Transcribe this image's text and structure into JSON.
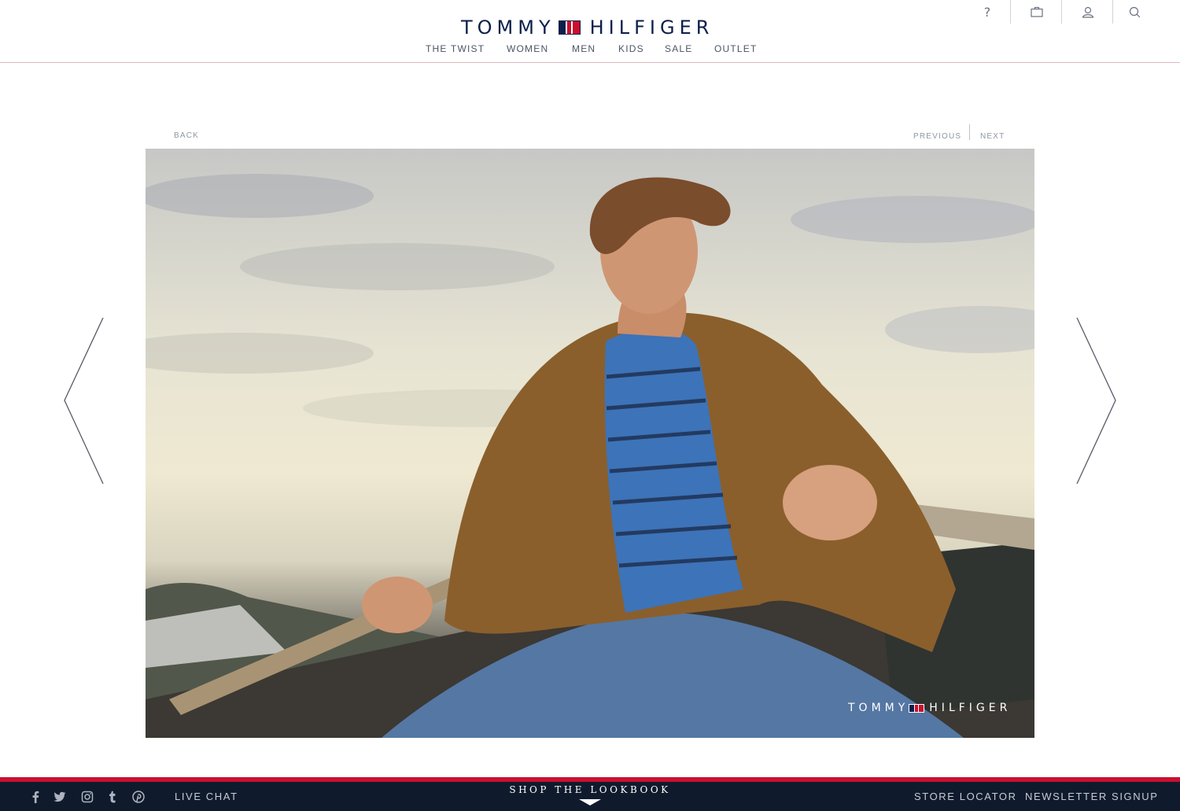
{
  "brand": {
    "word_left": "TOMMY",
    "word_right": "HILFIGER"
  },
  "nav": {
    "items": [
      {
        "label": "THE TWIST"
      },
      {
        "label": "WOMEN"
      },
      {
        "label": "MEN"
      },
      {
        "label": "KIDS"
      },
      {
        "label": "SALE"
      },
      {
        "label": "OUTLET"
      }
    ]
  },
  "utility": {
    "icons": [
      "help-icon",
      "shopping-bag-icon",
      "account-icon",
      "search-icon"
    ],
    "help_glyph": "?"
  },
  "lookbook_nav": {
    "back": "BACK",
    "previous": "PREVIOUS",
    "next": "NEXT"
  },
  "hero": {
    "watermark_left": "TOMMY",
    "watermark_right": "HILFIGER",
    "colors": {
      "jacket": "#8a5f2c",
      "sweater": "#3d73b8",
      "denim": "#5577a3",
      "sky": "#ebe6cf"
    }
  },
  "footer": {
    "social_icons": [
      "facebook-icon",
      "twitter-icon",
      "instagram-icon",
      "tumblr-icon",
      "pinterest-icon"
    ],
    "live_chat": "LIVE CHAT",
    "shop_lookbook": "SHOP THE LOOKBOOK",
    "store_locator": "STORE LOCATOR",
    "newsletter": "NEWSLETTER SIGNUP"
  },
  "colors": {
    "navy": "#0b1f4b",
    "red": "#c8102e",
    "footer_bg": "#0f1b2d",
    "nav_text": "#4b5566"
  }
}
